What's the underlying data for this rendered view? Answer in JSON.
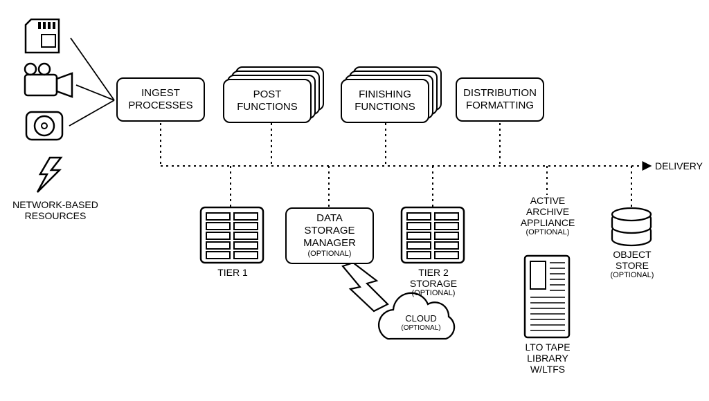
{
  "source_label": "NETWORK-BASED RESOURCES",
  "top_row": {
    "ingest": {
      "line1": "INGEST",
      "line2": "PROCESSES"
    },
    "post": {
      "line1": "POST",
      "line2": "FUNCTIONS"
    },
    "finishing": {
      "line1": "FINISHING",
      "line2": "FUNCTIONS"
    },
    "distribution": {
      "line1": "DISTRIBUTION",
      "line2": "FORMATTING"
    }
  },
  "delivery_label": "DELIVERY",
  "bottom_row": {
    "tier1": {
      "label": "TIER 1"
    },
    "dsm": {
      "line1": "DATA STORAGE",
      "line2": "MANAGER",
      "opt": "(OPTIONAL)"
    },
    "tier2": {
      "line1": "TIER 2 STORAGE",
      "opt": "(OPTIONAL)"
    },
    "archive": {
      "line1": "ACTIVE",
      "line2": "ARCHIVE",
      "line3": "APPLIANCE",
      "opt": "(OPTIONAL)"
    },
    "objstore": {
      "line1": "OBJECT",
      "line2": "STORE",
      "opt": "(OPTIONAL)"
    }
  },
  "cloud": {
    "label": "CLOUD",
    "opt": "(OPTIONAL)"
  },
  "lto": {
    "line1": "LTO TAPE",
    "line2": "LIBRARY",
    "line3": "W/LTFS"
  }
}
